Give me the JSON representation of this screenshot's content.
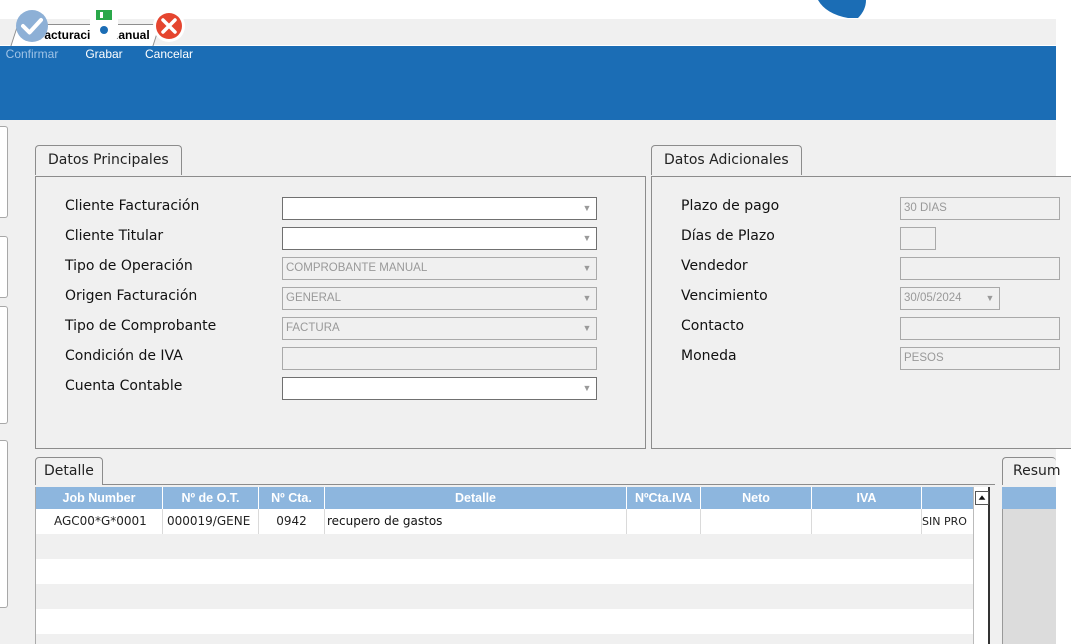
{
  "tab": {
    "title": "Facturación Manual"
  },
  "toolbar": {
    "confirm_label": "Confirmar",
    "save_label": "Grabar",
    "cancel_label": "Cancelar"
  },
  "principal": {
    "title": "Datos Principales",
    "fields": {
      "cliente_facturacion": {
        "label": "Cliente Facturación",
        "value": ""
      },
      "cliente_titular": {
        "label": "Cliente Titular",
        "value": ""
      },
      "tipo_operacion": {
        "label": "Tipo de Operación",
        "value": "COMPROBANTE MANUAL"
      },
      "origen_facturacion": {
        "label": "Origen Facturación",
        "value": "GENERAL"
      },
      "tipo_comprobante": {
        "label": "Tipo de Comprobante",
        "value": "FACTURA"
      },
      "condicion_iva": {
        "label": "Condición de IVA",
        "value": ""
      },
      "cuenta_contable": {
        "label": "Cuenta Contable",
        "value": ""
      }
    }
  },
  "adicionales": {
    "title": "Datos Adicionales",
    "fields": {
      "plazo_pago": {
        "label": "Plazo de pago",
        "value": "30 DIAS"
      },
      "dias_plazo": {
        "label": "Días de Plazo",
        "value": ""
      },
      "vendedor": {
        "label": "Vendedor",
        "value": ""
      },
      "vencimiento": {
        "label": "Vencimiento",
        "value": "30/05/2024"
      },
      "contacto": {
        "label": "Contacto",
        "value": ""
      },
      "moneda": {
        "label": "Moneda",
        "value": "PESOS"
      }
    }
  },
  "detalle": {
    "title": "Detalle",
    "columns": [
      "Job Number",
      "Nº de O.T.",
      "Nº Cta.",
      "Detalle",
      "NºCta.IVA",
      "Neto",
      "IVA",
      ""
    ],
    "rows": [
      {
        "job": "AGC00*G*0001",
        "ot": "000019/GENE",
        "cta": "0942",
        "detalle": "recupero de gastos",
        "cta_iva": "",
        "neto": "",
        "iva": "",
        "extra": "SIN PRO"
      }
    ]
  },
  "resumen": {
    "title": "Resum"
  },
  "colors": {
    "toolbar": "#1b6db5",
    "grid_header": "#8db6de",
    "panel": "#f0f0f0"
  }
}
